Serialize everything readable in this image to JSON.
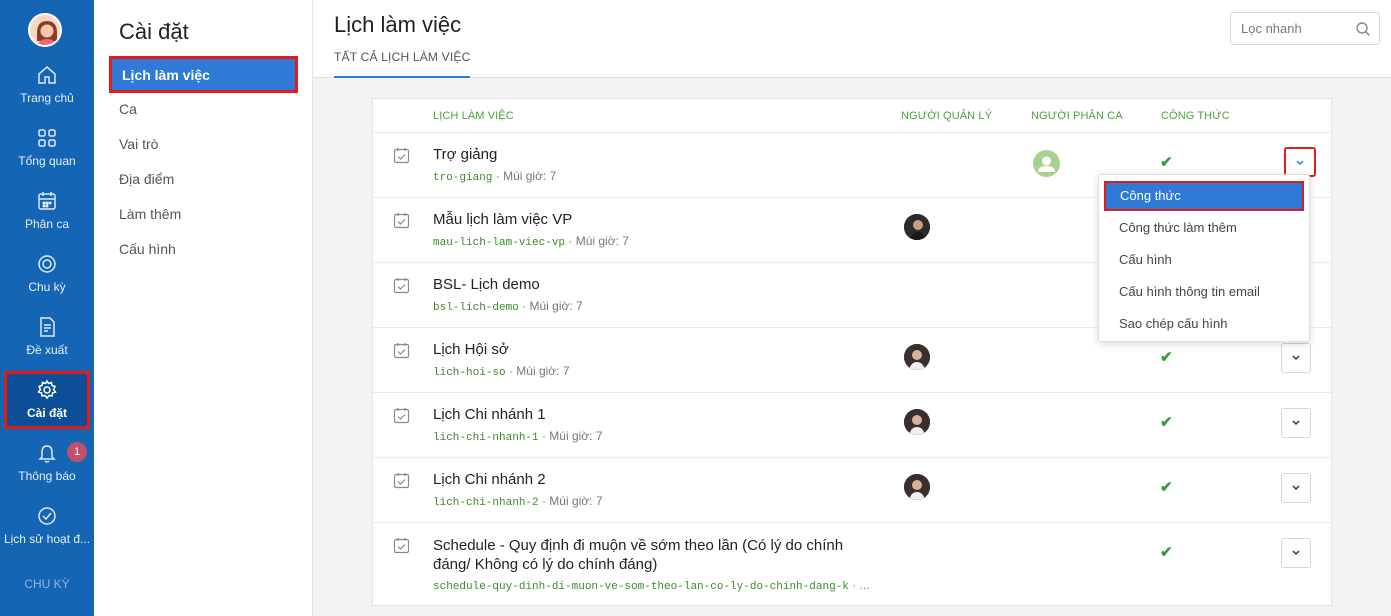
{
  "rail": {
    "items": [
      {
        "label": "Trang chủ",
        "icon": "home-icon"
      },
      {
        "label": "Tổng quan",
        "icon": "grid-icon"
      },
      {
        "label": "Phân ca",
        "icon": "calendar-icon"
      },
      {
        "label": "Chu kỳ",
        "icon": "cycle-icon"
      },
      {
        "label": "Đề xuất",
        "icon": "document-icon"
      },
      {
        "label": "Cài đặt",
        "icon": "gear-icon"
      },
      {
        "label": "Thông báo",
        "icon": "bell-icon"
      },
      {
        "label": "Lịch sử hoạt đ...",
        "icon": "check-circle-icon"
      }
    ],
    "badge": "1",
    "section_label": "CHU KỲ"
  },
  "settings": {
    "title": "Cài đặt",
    "items": [
      "Lịch làm việc",
      "Ca",
      "Vai trò",
      "Địa điểm",
      "Làm thêm",
      "Cấu hình"
    ]
  },
  "main": {
    "title": "Lịch làm việc",
    "tab": "TẤT CẢ LỊCH LÀM VIỆC",
    "search_placeholder": "Lọc nhanh"
  },
  "table": {
    "headers": {
      "name": "LỊCH LÀM VIỆC",
      "manager": "NGƯỜI QUẢN LÝ",
      "assigner": "NGƯỜI PHÂN CA",
      "formula": "CÔNG THỨC"
    },
    "rows": [
      {
        "name": "Trợ giảng",
        "slug": "tro-giang",
        "tz": " · Múi giờ: 7",
        "formula": "✔"
      },
      {
        "name": "Mẫu lịch làm việc VP",
        "slug": "mau-lich-lam-viec-vp",
        "tz": " · Múi giờ: 7"
      },
      {
        "name": "BSL- Lịch demo",
        "slug": "bsl-lich-demo",
        "tz": " · Múi giờ: 7"
      },
      {
        "name": "Lịch Hội sở",
        "slug": "lich-hoi-so",
        "tz": " · Múi giờ: 7",
        "formula": "✔"
      },
      {
        "name": "Lịch Chi nhánh 1",
        "slug": "lich-chi-nhanh-1",
        "tz": " · Múi giờ: 7",
        "formula": "✔"
      },
      {
        "name": "Lịch Chi nhánh 2",
        "slug": "lich-chi-nhanh-2",
        "tz": " · Múi giờ: 7",
        "formula": "✔"
      },
      {
        "name": "Schedule - Quy định đi muộn về sớm theo lần (Có lý do chính đáng/ Không có lý do chính đáng)",
        "slug": "schedule-quy-dinh-di-muon-ve-som-theo-lan-co-ly-do-chinh-dang-k",
        "tz": " · ...",
        "formula": "✔"
      }
    ]
  },
  "menu": {
    "items": [
      "Công thức",
      "Công thức làm thêm",
      "Cấu hình",
      "Cấu hình thông tin email",
      "Sao chép cấu hình"
    ]
  },
  "colors": {
    "rail": "#1565b5",
    "accent": "#2f7ad6",
    "highlight": "#e21b1b",
    "header_green": "#4aa33a"
  }
}
